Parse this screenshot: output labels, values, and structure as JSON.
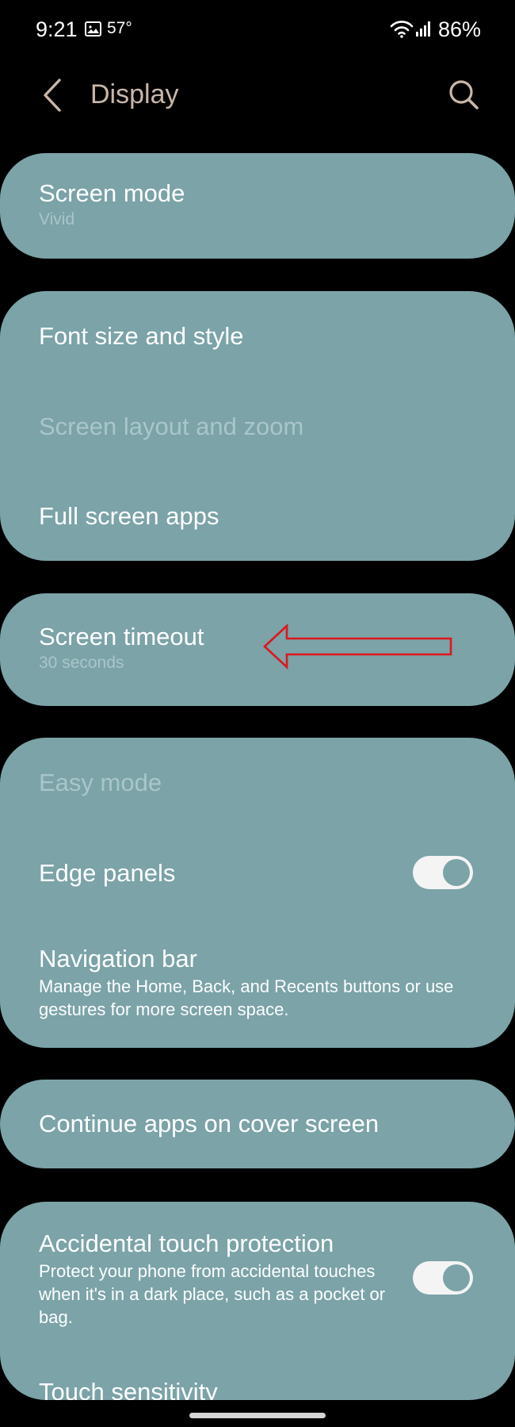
{
  "status_bar": {
    "time": "9:21",
    "temperature": "57°",
    "battery": "86%"
  },
  "header": {
    "title": "Display"
  },
  "settings": {
    "screen_mode": {
      "title": "Screen mode",
      "value": "Vivid"
    },
    "font_size": {
      "title": "Font size and style"
    },
    "screen_layout": {
      "title": "Screen layout and zoom"
    },
    "full_screen_apps": {
      "title": "Full screen apps"
    },
    "screen_timeout": {
      "title": "Screen timeout",
      "value": "30 seconds"
    },
    "easy_mode": {
      "title": "Easy mode"
    },
    "edge_panels": {
      "title": "Edge panels",
      "enabled": true
    },
    "navigation_bar": {
      "title": "Navigation bar",
      "description": "Manage the Home, Back, and Recents buttons or use gestures for more screen space."
    },
    "continue_apps": {
      "title": "Continue apps on cover screen"
    },
    "accidental_touch": {
      "title": "Accidental touch protection",
      "description": "Protect your phone from accidental touches when it's in a dark place, such as a pocket or bag.",
      "enabled": true
    },
    "touch_sensitivity": {
      "title": "Touch sensitivity"
    }
  },
  "colors": {
    "background": "#000000",
    "card": "#7ba3a8",
    "title_accent": "#c9b7a9",
    "disabled_text": "#a9c6ca",
    "annotation": "#e0161b"
  },
  "icons": {
    "back": "back-arrow-icon",
    "search": "search-icon",
    "gallery": "gallery-icon",
    "wifi": "wifi-icon",
    "signal": "signal-icon"
  }
}
